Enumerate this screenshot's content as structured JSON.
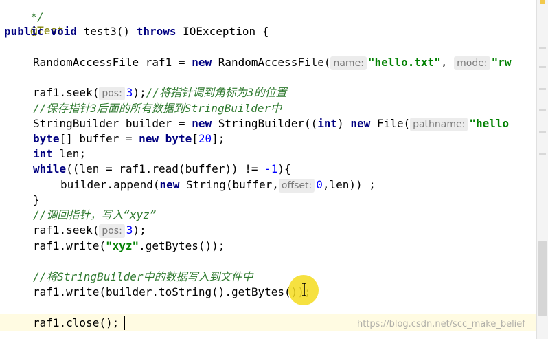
{
  "code": {
    "line0": "*/",
    "annotation": "@Test",
    "sig_public": "public",
    "sig_void": "void",
    "sig_name": "test3()",
    "sig_throws": "throws",
    "sig_exc": "IOException {",
    "l1_type": "RandomAccessFile raf1 = ",
    "l1_new": "new",
    "l1_ctor": " RandomAccessFile(",
    "l1_hint_name": "name:",
    "l1_str1": "\"hello.txt\"",
    "l1_comma": ",",
    "l1_hint_mode": "mode:",
    "l1_str2": "\"rw",
    "l2_call": "raf1.seek(",
    "l2_hint": "pos:",
    "l2_num": "3",
    "l2_end": ");",
    "l2_comment": "//将指针调到角标为3的位置",
    "l3_comment": "//保存指针3后面的所有数据到StringBuilder中",
    "l4_a": "StringBuilder builder = ",
    "l4_new": "new",
    "l4_b": " StringBuilder((",
    "l4_int": "int",
    "l4_c": ") ",
    "l4_new2": "new",
    "l4_d": " File(",
    "l4_hint": "pathname:",
    "l4_str": "\"hello",
    "l5_byte": "byte",
    "l5_a": "[] buffer = ",
    "l5_new": "new",
    "l5_byte2": "byte",
    "l5_b": "[",
    "l5_num": "20",
    "l5_c": "];",
    "l6_int": "int",
    "l6_a": " len;",
    "l7_while": "while",
    "l7_a": "((len = raf1.read(buffer)) != ",
    "l7_num": "-1",
    "l7_b": "){",
    "l8_a": "builder.append(",
    "l8_new": "new",
    "l8_b": " String(buffer,",
    "l8_hint": "offset:",
    "l8_num": "0",
    "l8_c": ",len)) ;",
    "l9": "}",
    "l10_comment": "//调回指针，写入“xyz”",
    "l11_call": "raf1.seek(",
    "l11_hint": "pos:",
    "l11_num": "3",
    "l11_end": ");",
    "l12_a": "raf1.write(",
    "l12_str": "\"xyz\"",
    "l12_b": ".getBytes());",
    "l13_comment": "//将StringBuilder中的数据写入到文件中",
    "l14": "raf1.write(builder.toString().getBytes());",
    "l15": "raf1.close();"
  },
  "watermark": "https://blog.csdn.net/scc_make_belief"
}
